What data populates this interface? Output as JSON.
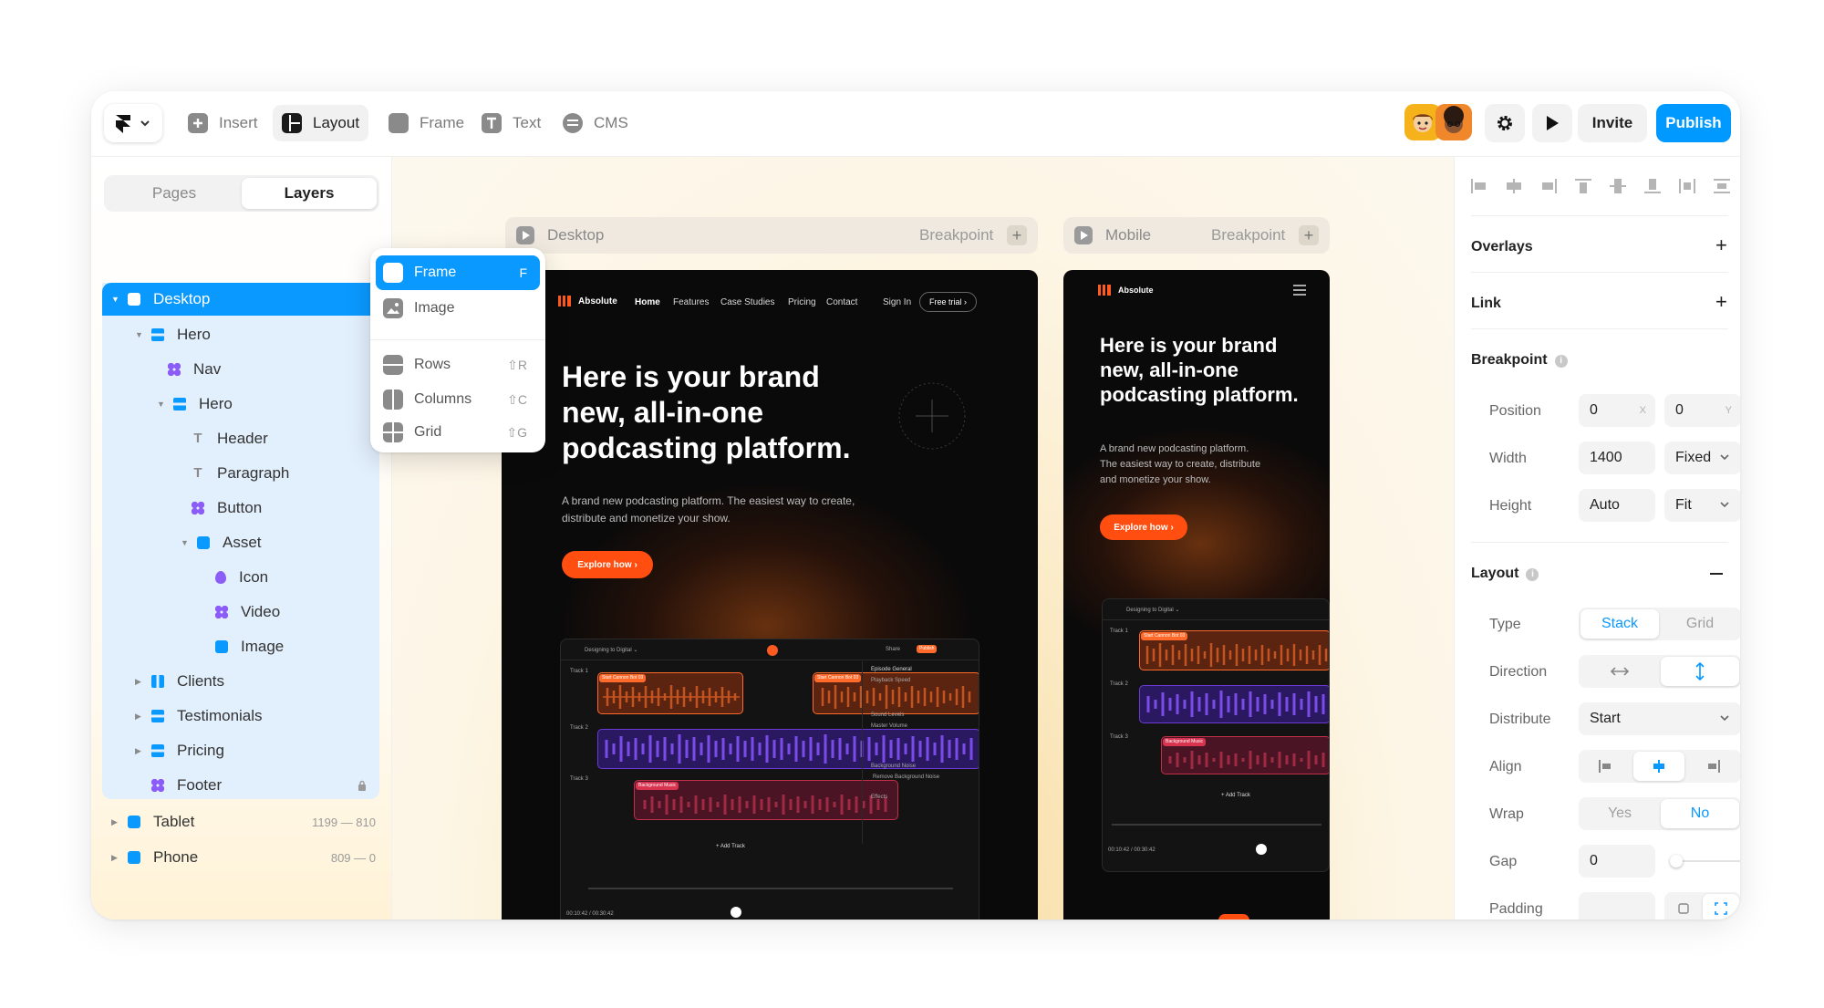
{
  "toolbar": {
    "items": [
      {
        "label": "Insert",
        "icon": "plus-square-icon"
      },
      {
        "label": "Layout",
        "icon": "layout-icon"
      },
      {
        "label": "Frame",
        "icon": "frame-icon"
      },
      {
        "label": "Text",
        "icon": "text-icon"
      },
      {
        "label": "CMS",
        "icon": "database-icon"
      }
    ],
    "active": "Layout",
    "invite_label": "Invite",
    "publish_label": "Publish",
    "accent": "#0099ff"
  },
  "layout_menu": {
    "items": [
      {
        "label": "Frame",
        "shortcut": "F",
        "selected": true
      },
      {
        "label": "Image",
        "shortcut": ""
      },
      {
        "label": "Rows",
        "shortcut": "⇧R"
      },
      {
        "label": "Columns",
        "shortcut": "⇧C"
      },
      {
        "label": "Grid",
        "shortcut": "⇧G"
      }
    ]
  },
  "left_panel": {
    "tabs": [
      "Pages",
      "Layers"
    ],
    "active_tab": "Layers",
    "layers": [
      {
        "label": "Desktop",
        "icon": "frame-icon",
        "selected": true
      },
      {
        "label": "Hero",
        "icon": "stack-icon"
      },
      {
        "label": "Nav",
        "icon": "component-icon"
      },
      {
        "label": "Hero",
        "icon": "stack-icon"
      },
      {
        "label": "Header",
        "icon": "text-icon"
      },
      {
        "label": "Paragraph",
        "icon": "text-icon"
      },
      {
        "label": "Button",
        "icon": "component-icon"
      },
      {
        "label": "Asset",
        "icon": "frame-icon"
      },
      {
        "label": "Icon",
        "icon": "drop-icon"
      },
      {
        "label": "Video",
        "icon": "component-icon"
      },
      {
        "label": "Image",
        "icon": "frame-icon"
      },
      {
        "label": "Clients",
        "icon": "columns-icon"
      },
      {
        "label": "Testimonials",
        "icon": "stack-icon"
      },
      {
        "label": "Pricing",
        "icon": "stack-icon"
      },
      {
        "label": "Footer",
        "icon": "component-icon",
        "locked": true
      },
      {
        "label": "Tablet",
        "icon": "frame-icon",
        "meta": "1199 — 810"
      },
      {
        "label": "Phone",
        "icon": "frame-icon",
        "meta": "809 — 0"
      }
    ]
  },
  "canvas": {
    "desktop": {
      "name": "Desktop",
      "breakpoint_label": "Breakpoint"
    },
    "mobile": {
      "name": "Mobile",
      "breakpoint_label": "Breakpoint"
    },
    "site": {
      "brand": "Absolute",
      "nav": [
        "Home",
        "Features",
        "Case Studies",
        "Pricing",
        "Contact"
      ],
      "sign_in": "Sign In",
      "trial": "Free trial ›",
      "headline_lines": [
        "Here is your brand",
        "new, all-in-one",
        "podcasting platform."
      ],
      "sub_desktop_lines": [
        "A brand new podcasting platform. The easiest way to create,",
        "distribute  and monetize your show."
      ],
      "sub_mobile_lines": [
        "A brand new podcasting platform.",
        "The easiest way to create, distribute",
        "and monetize your show."
      ],
      "cta": "Explore how ›",
      "app_title": "Designing to Digital ⌄",
      "tracks": [
        "Track 1",
        "Track 2",
        "Track 3"
      ],
      "add_track": "+ Add Track",
      "panel_labels": [
        "Episode General",
        "Playback Speed",
        "Sound Levels",
        "Master Volume",
        "Background Noise",
        "Remove Background Noise",
        "Effects"
      ],
      "share": "Share",
      "publish": "Publish",
      "clip_labels": [
        "Start Cannon Bot 03",
        "Start Cannon Bot 03",
        "Background Music"
      ],
      "time": "00:10:42 / 00:30:42",
      "colors": {
        "orange": "#ff4e0f",
        "purple": "#6b3bd6",
        "red": "#a0243a",
        "orange_dark": "#6a2a10"
      }
    }
  },
  "right_panel": {
    "overlays_label": "Overlays",
    "link_label": "Link",
    "breakpoint": {
      "title": "Breakpoint",
      "position_label": "Position",
      "x": "0",
      "x_tag": "X",
      "y": "0",
      "y_tag": "Y",
      "width_label": "Width",
      "width": "1400",
      "width_mode": "Fixed",
      "height_label": "Height",
      "height": "Auto",
      "height_mode": "Fit"
    },
    "layout": {
      "title": "Layout",
      "type_label": "Type",
      "type_options": [
        "Stack",
        "Grid"
      ],
      "type_selected": "Stack",
      "direction_label": "Direction",
      "direction_options": [
        "horizontal",
        "vertical"
      ],
      "direction_selected": "vertical",
      "distribute_label": "Distribute",
      "distribute_value": "Start",
      "align_label": "Align",
      "align_selected": "center",
      "wrap_label": "Wrap",
      "wrap_options": [
        "Yes",
        "No"
      ],
      "wrap_selected": "No",
      "gap_label": "Gap",
      "gap_value": "0",
      "padding_label": "Padding"
    }
  }
}
